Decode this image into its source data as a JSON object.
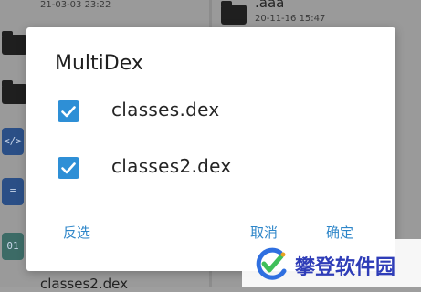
{
  "background": {
    "left_column": {
      "top_timestamp": "21-03-03 23:22",
      "bottom_file_name": "classes2.dex"
    },
    "right_column": {
      "folder_name": ".aaa",
      "folder_timestamp": "20-11-16 15:47"
    }
  },
  "dialog": {
    "title": "MultiDex",
    "options": [
      {
        "label": "classes.dex",
        "checked": true
      },
      {
        "label": "classes2.dex",
        "checked": true
      }
    ],
    "actions": {
      "invert_label": "反选",
      "cancel_label": "取消",
      "ok_label": "确定"
    }
  },
  "watermark": {
    "text": "攀登软件园"
  },
  "colors": {
    "accent": "#2e8fd6",
    "action_text": "#2e86c9",
    "watermark_text": "#2f3db8"
  }
}
